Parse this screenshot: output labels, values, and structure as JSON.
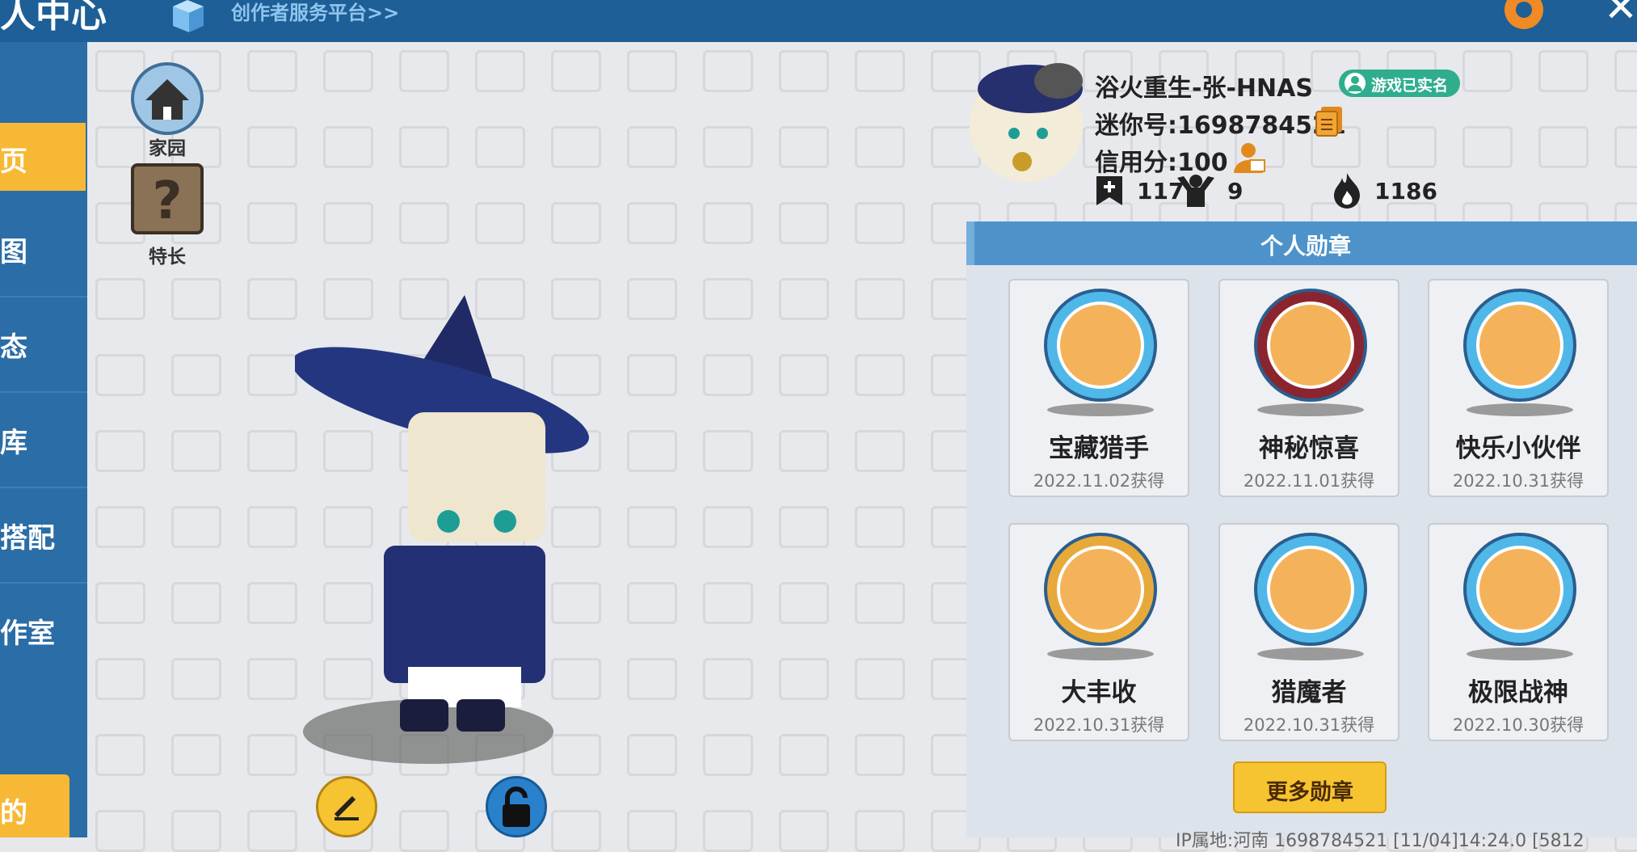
{
  "header": {
    "title": "人中心",
    "creator_link": "创作者服务平台>>"
  },
  "nav": {
    "items": [
      {
        "label": "页"
      },
      {
        "label": "图"
      },
      {
        "label": "态"
      },
      {
        "label": "库"
      },
      {
        "label": "搭配"
      },
      {
        "label": "作室"
      }
    ],
    "bottom_label": "的"
  },
  "side": {
    "home_label": "家园",
    "specialty_label": "特长"
  },
  "profile": {
    "name": "浴火重生-张-HNAS",
    "verified": "游戏已实名",
    "mini_id": "迷你号:1698784521",
    "credit": "信用分:100",
    "stats": {
      "a": "117",
      "b": "9",
      "c": "1186"
    }
  },
  "medals": {
    "header": "个人勋章",
    "items": [
      {
        "name": "宝藏猎手",
        "date": "2022.11.02获得",
        "color": "#4fb8e8"
      },
      {
        "name": "神秘惊喜",
        "date": "2022.11.01获得",
        "color": "#8a2530"
      },
      {
        "name": "快乐小伙伴",
        "date": "2022.10.31获得",
        "color": "#4fb8e8"
      },
      {
        "name": "大丰收",
        "date": "2022.10.31获得",
        "color": "#e8a93b"
      },
      {
        "name": "猎魔者",
        "date": "2022.10.31获得",
        "color": "#4fb8e8"
      },
      {
        "name": "极限战神",
        "date": "2022.10.30获得",
        "color": "#4fb8e8"
      }
    ],
    "more_label": "更多勋章"
  },
  "footer": "IP属地:河南  1698784521  [11/04]14:24.0  [5812"
}
